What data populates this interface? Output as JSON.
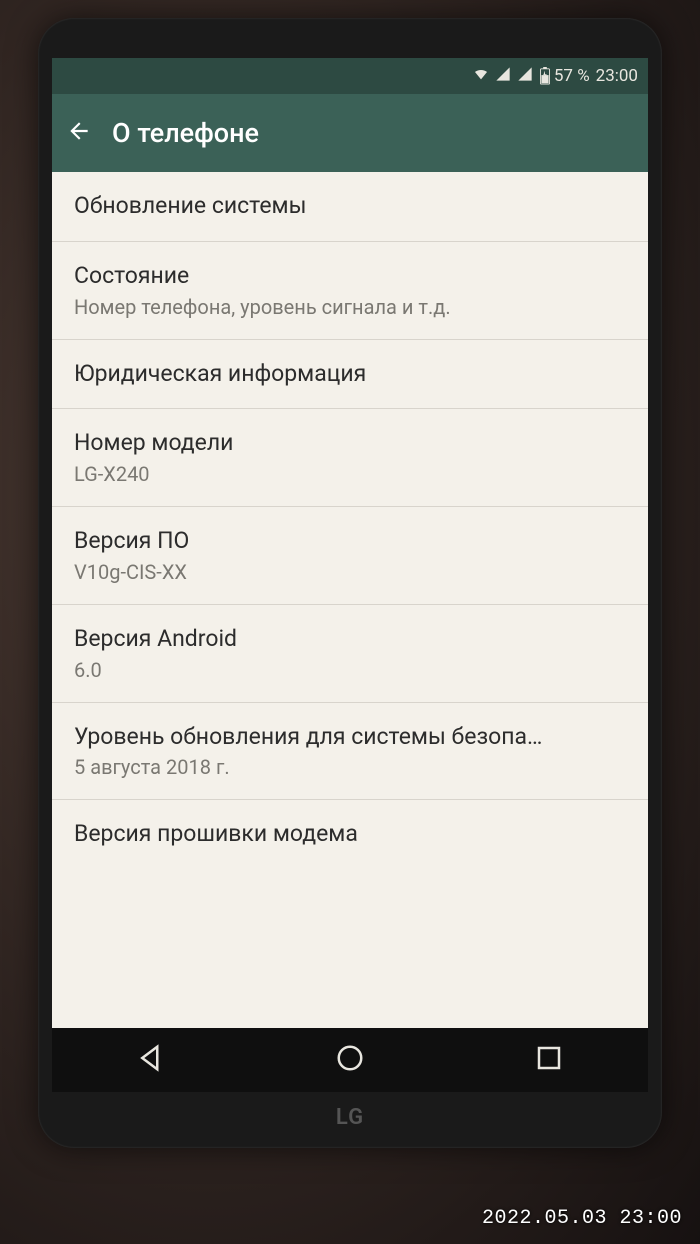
{
  "statusbar": {
    "battery_pct": "57 %",
    "time": "23:00"
  },
  "appbar": {
    "title": "О телефоне"
  },
  "items": [
    {
      "title": "Обновление системы",
      "subtitle": null
    },
    {
      "title": "Состояние",
      "subtitle": "Номер телефона, уровень сигнала и т.д."
    },
    {
      "title": "Юридическая информация",
      "subtitle": null
    },
    {
      "title": "Номер модели",
      "subtitle": "LG-X240"
    },
    {
      "title": "Версия ПО",
      "subtitle": "V10g-CIS-XX"
    },
    {
      "title": "Версия Android",
      "subtitle": "6.0"
    },
    {
      "title": "Уровень обновления для системы безопа…",
      "subtitle": "5 августа 2018 г."
    },
    {
      "title": "Версия прошивки модема",
      "subtitle": null
    }
  ],
  "phone_logo": "LG",
  "camera_timestamp": "2022.05.03 23:00"
}
